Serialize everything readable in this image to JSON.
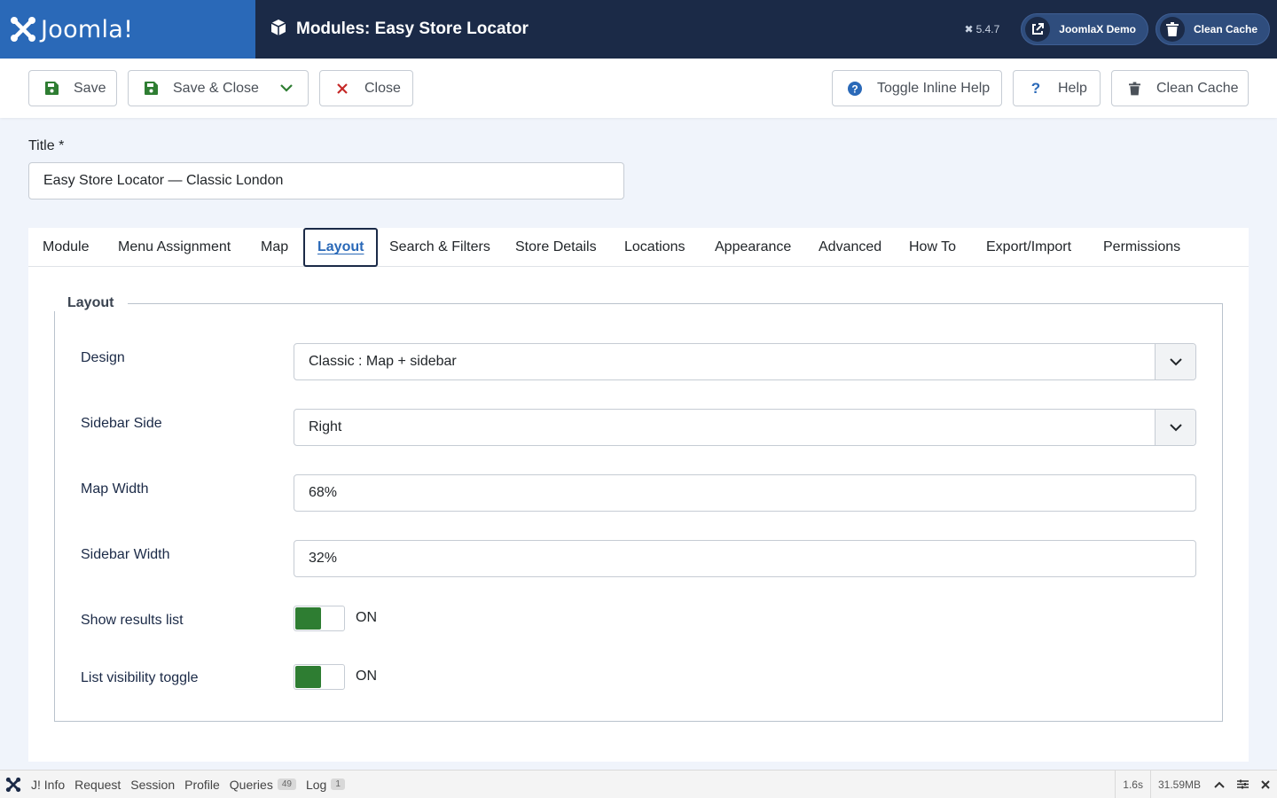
{
  "header": {
    "brand_text": "Joomla!",
    "page_title": "Modules: Easy Store Locator",
    "version": "5.4.7",
    "demo_pill": "JoomlaX Demo",
    "cache_pill": "Clean Cache"
  },
  "toolbar": {
    "save": "Save",
    "save_close": "Save & Close",
    "close": "Close",
    "toggle_help": "Toggle Inline Help",
    "help": "Help",
    "clean_cache": "Clean Cache"
  },
  "title_field": {
    "label": "Title *",
    "value": "Easy Store Locator — Classic London"
  },
  "tabs": [
    {
      "label": "Module"
    },
    {
      "label": "Menu Assignment"
    },
    {
      "label": "Map"
    },
    {
      "label": "Layout",
      "active": true
    },
    {
      "label": "Search & Filters"
    },
    {
      "label": "Store Details"
    },
    {
      "label": "Locations"
    },
    {
      "label": "Appearance"
    },
    {
      "label": "Advanced"
    },
    {
      "label": "How To"
    },
    {
      "label": "Export/Import"
    },
    {
      "label": "Permissions"
    }
  ],
  "layout": {
    "legend": "Layout",
    "design": {
      "label": "Design",
      "value": "Classic : Map + sidebar"
    },
    "sidebar_side": {
      "label": "Sidebar Side",
      "value": "Right"
    },
    "map_width": {
      "label": "Map Width",
      "value": "68%"
    },
    "sidebar_width": {
      "label": "Sidebar Width",
      "value": "32%"
    },
    "show_results": {
      "label": "Show results list",
      "state": "ON"
    },
    "list_toggle": {
      "label": "List visibility toggle",
      "state": "ON"
    }
  },
  "debugbar": {
    "items": [
      {
        "label": "J! Info"
      },
      {
        "label": "Request"
      },
      {
        "label": "Session"
      },
      {
        "label": "Profile"
      },
      {
        "label": "Queries",
        "badge": "49"
      },
      {
        "label": "Log",
        "badge": "1"
      }
    ],
    "time": "1.6s",
    "memory": "31.59MB"
  },
  "colors": {
    "header_bg": "#1b2a47",
    "brand_bg": "#2a69b8",
    "switch_on": "#2e7d32",
    "close_red": "#c52827",
    "help_blue": "#2a69b8"
  }
}
